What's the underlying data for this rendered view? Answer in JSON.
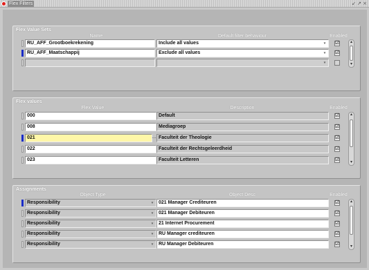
{
  "window": {
    "title": "Flex Filters",
    "controls": "↙ ↗ ×"
  },
  "flex_value_sets": {
    "title": "Flex Value Sets",
    "headers": {
      "name": "Name",
      "behaviour": "Default filter behaviour",
      "enabled": "Enabled"
    },
    "rows": [
      {
        "name": "RU_AFF_Grootboekrekening",
        "behaviour": "Include all values",
        "enabled": true
      },
      {
        "name": "RU_AFF_Maatschappij",
        "behaviour": "Exclude all values",
        "enabled": true
      },
      {
        "name": "",
        "behaviour": "",
        "enabled": false
      }
    ]
  },
  "flex_values": {
    "title": "Flex values",
    "headers": {
      "value": "Flex Value",
      "description": "Description",
      "enabled": "Enabled"
    },
    "rows": [
      {
        "value": "000",
        "description": "Default",
        "enabled": true
      },
      {
        "value": "008",
        "description": "Mediagroep",
        "enabled": true
      },
      {
        "value": "021",
        "description": "Faculteit der Theologie",
        "enabled": true
      },
      {
        "value": "022",
        "description": "Faculteit der Rechtsgeleerdheid",
        "enabled": true
      },
      {
        "value": "023",
        "description": "Faculteit Letteren",
        "enabled": true
      }
    ]
  },
  "assignments": {
    "title": "Assignments",
    "headers": {
      "type": "Object Type",
      "desc": "Object Desc",
      "enabled": "Enabled"
    },
    "rows": [
      {
        "type": "Responsibility",
        "desc": "021 Manager Crediteuren",
        "enabled": true
      },
      {
        "type": "Responsibility",
        "desc": "021 Manager Debiteuren",
        "enabled": true
      },
      {
        "type": "Responsibility",
        "desc": "21 Internet Procurement",
        "enabled": true
      },
      {
        "type": "Responsibility",
        "desc": "RU Manager crediteuren",
        "enabled": true
      },
      {
        "type": "Responsibility",
        "desc": "RU Manager Debiteuren",
        "enabled": true
      }
    ]
  },
  "icons": {
    "check": "☑",
    "dropdown": "▾",
    "scroll_up": "▴",
    "scroll_down": "▾",
    "lov": "…"
  },
  "colors": {
    "current_record": "#1a2cc8",
    "editing_field": "#fff7a8",
    "window_icon": "#e0201c"
  }
}
